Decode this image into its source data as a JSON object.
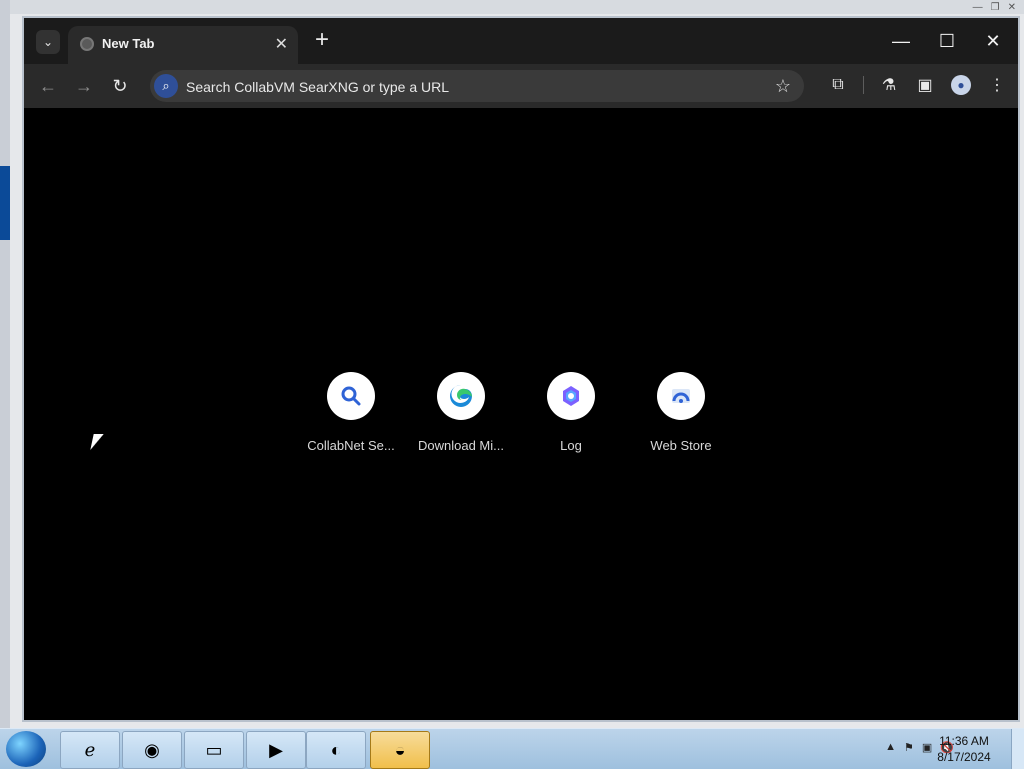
{
  "browser": {
    "tab_title": "New Tab",
    "new_tab_symbol": "+",
    "close_symbol": "✕",
    "search_placeholder": "Search CollabVM SearXNG or type a URL",
    "shortcuts": [
      {
        "label": "CollabNet Se...",
        "icon": "search-icon"
      },
      {
        "label": "Download Mi...",
        "icon": "edge-icon"
      },
      {
        "label": "Log",
        "icon": "copilot-icon"
      },
      {
        "label": "Web Store",
        "icon": "web-store-icon"
      }
    ]
  },
  "taskbar": {
    "time": "11:36 AM",
    "date": "8/17/2024"
  }
}
